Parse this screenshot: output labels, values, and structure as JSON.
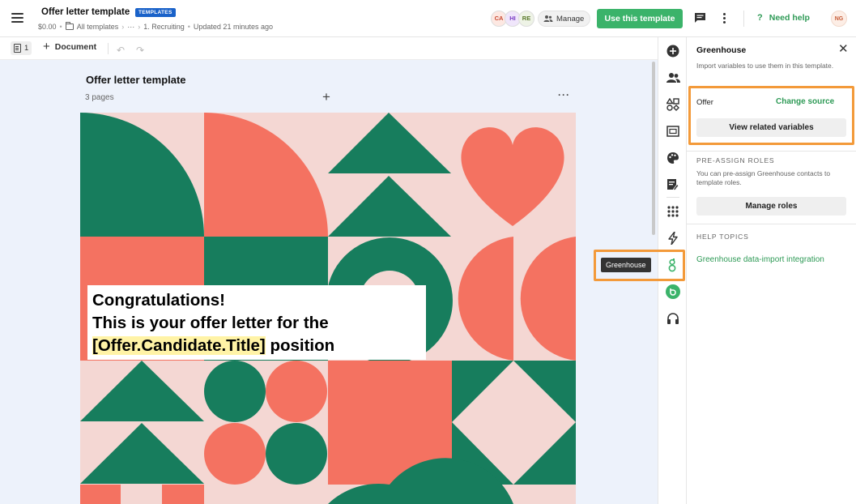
{
  "header": {
    "title": "Offer letter template",
    "badge": "TEMPLATES",
    "price": "$0.00",
    "breadcrumb_all": "All templates",
    "breadcrumb_more": "···",
    "breadcrumb_folder": "1. Recruiting",
    "updated": "Updated 21 minutes ago",
    "collaborators": [
      "CA",
      "HI",
      "RE"
    ],
    "manage_label": "Manage",
    "use_template_label": "Use this template",
    "need_help_label": "Need help",
    "user_initials": "NG"
  },
  "toolbar": {
    "page_count": "1",
    "add_document_label": "Document"
  },
  "canvas": {
    "title": "Offer letter template",
    "pages_label": "3 pages",
    "more_label": "···"
  },
  "document": {
    "line1": "Congratulations!",
    "line2": "This is your offer letter for the",
    "variable": "[Offer.Candidate.Title]",
    "line3_suffix": " position"
  },
  "tooltip": {
    "label": "Greenhouse"
  },
  "panel": {
    "title": "Greenhouse",
    "description": "Import variables to use them in this template.",
    "offer_label": "Offer",
    "change_source_label": "Change source",
    "view_related_label": "View related variables",
    "preassign_heading": "PRE-ASSIGN ROLES",
    "preassign_description": "You can pre-assign Greenhouse contacts to template roles.",
    "manage_roles_label": "Manage roles",
    "help_topics_heading": "HELP TOPICS",
    "help_link_label": "Greenhouse data-import integration"
  },
  "colors": {
    "accent_green": "#3bb36a",
    "link_green": "#2e9a56",
    "highlight_orange": "#f39a3a",
    "shape_green": "#177d5d",
    "shape_coral": "#f47261",
    "page_pink": "#f4d7d3"
  },
  "icons": [
    "menu-icon",
    "folder-icon",
    "users-icon",
    "chat-icon",
    "more-vertical-icon",
    "help-icon",
    "page-icon",
    "plus-icon",
    "undo-icon",
    "redo-icon",
    "add-circle-icon",
    "people-icon",
    "shapes-icon",
    "media-icon",
    "palette-icon",
    "fields-icon",
    "apps-icon",
    "lightning-icon",
    "greenhouse-icon",
    "integration-icon",
    "headset-icon",
    "close-icon"
  ]
}
